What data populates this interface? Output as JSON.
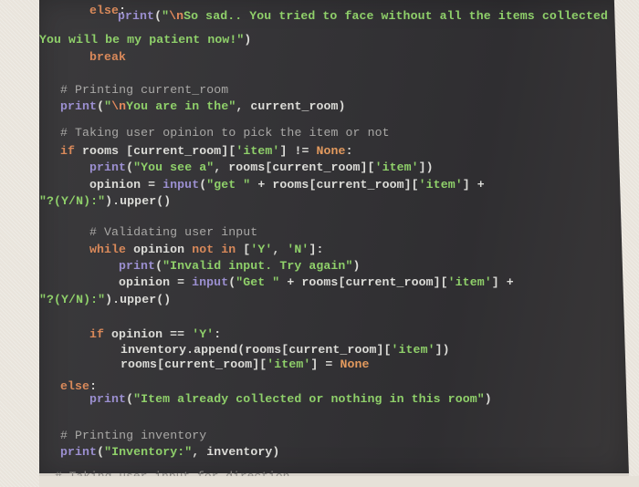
{
  "editor": {
    "theme": "dark",
    "colors": {
      "background": "#333235",
      "keyword": "#d9895a",
      "function": "#9b8fd0",
      "string": "#8fd06a",
      "comment": "#a9a8a6",
      "constant": "#e39a5e",
      "text": "#dcdcd8"
    },
    "lines": [
      {
        "tokens": [
          {
            "t": "kw",
            "v": "else"
          },
          {
            "t": "op",
            "v": ":"
          }
        ]
      },
      {
        "tokens": [
          {
            "t": "fn",
            "v": "print"
          },
          {
            "t": "op",
            "v": "("
          },
          {
            "t": "str",
            "v": "\""
          },
          {
            "t": "esc",
            "v": "\\n"
          },
          {
            "t": "str",
            "v": "So sad.. You tried to face without all the items collected"
          }
        ]
      },
      {
        "tokens": [
          {
            "t": "str",
            "v": "You will be my patient now!\""
          },
          {
            "t": "op",
            "v": ")"
          }
        ]
      },
      {
        "tokens": [
          {
            "t": "kw",
            "v": "break"
          }
        ]
      },
      {
        "tokens": [
          {
            "t": "cm",
            "v": "# Printing current_room"
          }
        ]
      },
      {
        "tokens": [
          {
            "t": "fn",
            "v": "print"
          },
          {
            "t": "op",
            "v": "("
          },
          {
            "t": "str",
            "v": "\""
          },
          {
            "t": "esc",
            "v": "\\n"
          },
          {
            "t": "str",
            "v": "You are in the\""
          },
          {
            "t": "op",
            "v": ", current_room)"
          }
        ]
      },
      {
        "tokens": [
          {
            "t": "cm",
            "v": "# Taking user opinion to pick the item or not"
          }
        ]
      },
      {
        "tokens": [
          {
            "t": "kw",
            "v": "if"
          },
          {
            "t": "op",
            "v": " rooms [current_room]["
          },
          {
            "t": "str",
            "v": "'item'"
          },
          {
            "t": "op",
            "v": "] != "
          },
          {
            "t": "cst",
            "v": "None"
          },
          {
            "t": "op",
            "v": ":"
          }
        ]
      },
      {
        "tokens": [
          {
            "t": "fn",
            "v": "print"
          },
          {
            "t": "op",
            "v": "("
          },
          {
            "t": "str",
            "v": "\"You see a\""
          },
          {
            "t": "op",
            "v": ", rooms[current_room]["
          },
          {
            "t": "str",
            "v": "'item'"
          },
          {
            "t": "op",
            "v": "])"
          }
        ]
      },
      {
        "tokens": [
          {
            "t": "op",
            "v": "opinion = "
          },
          {
            "t": "fn",
            "v": "input"
          },
          {
            "t": "op",
            "v": "("
          },
          {
            "t": "str",
            "v": "\"get \""
          },
          {
            "t": "op",
            "v": " + rooms[current_room]["
          },
          {
            "t": "str",
            "v": "'item'"
          },
          {
            "t": "op",
            "v": "] +"
          }
        ]
      },
      {
        "tokens": [
          {
            "t": "str",
            "v": "\"?(Y/N):\""
          },
          {
            "t": "op",
            "v": ").upper()"
          }
        ]
      },
      {
        "tokens": [
          {
            "t": "cm",
            "v": "# Validating user input"
          }
        ]
      },
      {
        "tokens": [
          {
            "t": "kw",
            "v": "while"
          },
          {
            "t": "op",
            "v": " opinion "
          },
          {
            "t": "kw",
            "v": "not in"
          },
          {
            "t": "op",
            "v": " ["
          },
          {
            "t": "str",
            "v": "'Y'"
          },
          {
            "t": "op",
            "v": ", "
          },
          {
            "t": "str",
            "v": "'N'"
          },
          {
            "t": "op",
            "v": "]:"
          }
        ]
      },
      {
        "tokens": [
          {
            "t": "fn",
            "v": "print"
          },
          {
            "t": "op",
            "v": "("
          },
          {
            "t": "str",
            "v": "\"Invalid input. Try again\""
          },
          {
            "t": "op",
            "v": ")"
          }
        ]
      },
      {
        "tokens": [
          {
            "t": "op",
            "v": "opinion = "
          },
          {
            "t": "fn",
            "v": "input"
          },
          {
            "t": "op",
            "v": "("
          },
          {
            "t": "str",
            "v": "\"Get \""
          },
          {
            "t": "op",
            "v": " + rooms[current_room]["
          },
          {
            "t": "str",
            "v": "'item'"
          },
          {
            "t": "op",
            "v": "] +"
          }
        ]
      },
      {
        "tokens": [
          {
            "t": "str",
            "v": "\"?(Y/N):\""
          },
          {
            "t": "op",
            "v": ").upper()"
          }
        ]
      },
      {
        "tokens": [
          {
            "t": "kw",
            "v": "if"
          },
          {
            "t": "op",
            "v": " opinion == "
          },
          {
            "t": "str",
            "v": "'Y'"
          },
          {
            "t": "op",
            "v": ":"
          }
        ]
      },
      {
        "tokens": [
          {
            "t": "op",
            "v": "inventory.append(rooms[current_room]["
          },
          {
            "t": "str",
            "v": "'item'"
          },
          {
            "t": "op",
            "v": "])"
          }
        ]
      },
      {
        "tokens": [
          {
            "t": "op",
            "v": "rooms[current_room]["
          },
          {
            "t": "str",
            "v": "'item'"
          },
          {
            "t": "op",
            "v": "] = "
          },
          {
            "t": "cst",
            "v": "None"
          }
        ]
      },
      {
        "tokens": [
          {
            "t": "kw",
            "v": "else"
          },
          {
            "t": "op",
            "v": ":"
          }
        ]
      },
      {
        "tokens": [
          {
            "t": "fn",
            "v": "print"
          },
          {
            "t": "op",
            "v": "("
          },
          {
            "t": "str",
            "v": "\"Item already collected or nothing in this room\""
          },
          {
            "t": "op",
            "v": ")"
          }
        ]
      },
      {
        "tokens": [
          {
            "t": "cm",
            "v": "# Printing inventory"
          }
        ]
      },
      {
        "tokens": [
          {
            "t": "fn",
            "v": "print"
          },
          {
            "t": "op",
            "v": "("
          },
          {
            "t": "str",
            "v": "\"Inventory:\""
          },
          {
            "t": "op",
            "v": ", inventory)"
          }
        ]
      }
    ],
    "partial_cut_line": "# Taking user input for direction"
  }
}
